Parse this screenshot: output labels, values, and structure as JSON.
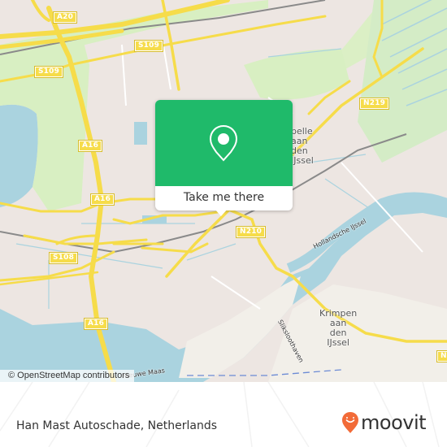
{
  "map": {
    "road_labels": [
      {
        "id": "a20",
        "text": "A20"
      },
      {
        "id": "s109-a",
        "text": "S109"
      },
      {
        "id": "s109-b",
        "text": "S109"
      },
      {
        "id": "a16-a",
        "text": "A16"
      },
      {
        "id": "a16-b",
        "text": "A16"
      },
      {
        "id": "s108",
        "text": "S108"
      },
      {
        "id": "a16-c",
        "text": "A16"
      },
      {
        "id": "n219",
        "text": "N219"
      },
      {
        "id": "n210",
        "text": "N210"
      },
      {
        "id": "n-partial",
        "text": "N"
      }
    ],
    "place_labels": {
      "capelle": "Capelle\naan\nden\nIJssel",
      "capelle_visible": "pelle\naan\nden\nIJssel",
      "krimpen": "Krimpen\naan\nden\nIJssel"
    },
    "water_labels": {
      "hollandsche_ijssel": "Hollandsche IJssel",
      "nieuwe_maas": "Nieuwe Maas",
      "sliksloothaven": "Sliksloothaven"
    },
    "colors": {
      "land": "#f2efe9",
      "urban": "#ede4e4",
      "park": "#d8efc2",
      "water": "#aad3df",
      "motorway": "#f6dc4a",
      "rail": "#8a8a8a"
    }
  },
  "popup": {
    "button_label": "Take me there",
    "pin_icon": "map-pin-icon",
    "color": "#1fba6a"
  },
  "attribution": "© OpenStreetMap contributors",
  "footer": {
    "place_title": "Han Mast Autoschade, Netherlands",
    "brand": "moovit",
    "brand_color": "#f26b38"
  }
}
